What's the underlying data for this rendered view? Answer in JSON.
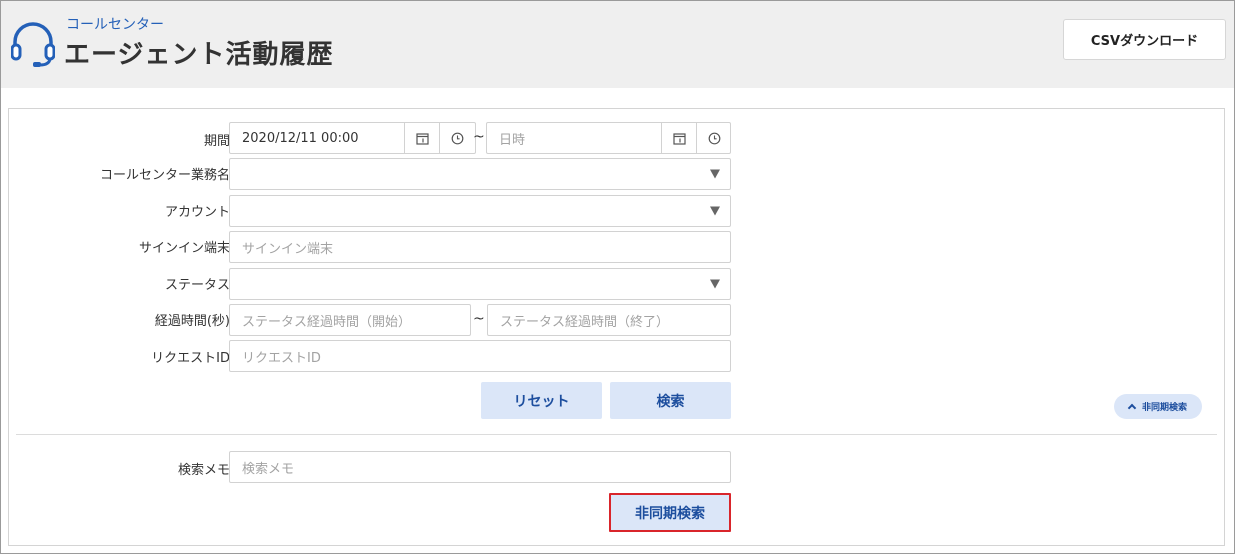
{
  "header": {
    "breadcrumb": "コールセンター",
    "title": "エージェント活動履歴",
    "csv_label": "CSVダウンロード",
    "icon": "headset-icon",
    "accent": "#2460b8"
  },
  "form": {
    "period": {
      "label": "期間",
      "start_value": "2020/12/11 00:00",
      "separator": "~",
      "end_placeholder": "日時",
      "calendar_icon": "calendar-icon",
      "clock_icon": "clock-icon"
    },
    "callcenter": {
      "label": "コールセンター業務名",
      "value": ""
    },
    "account": {
      "label": "アカウント",
      "value": ""
    },
    "signin": {
      "label": "サインイン端末",
      "placeholder": "サインイン端末"
    },
    "status": {
      "label": "ステータス",
      "value": ""
    },
    "elapsed": {
      "label": "経過時間(秒)",
      "start_placeholder": "ステータス経過時間（開始）",
      "separator": "~",
      "end_placeholder": "ステータス経過時間（終了）"
    },
    "request": {
      "label": "リクエストID",
      "placeholder": "リクエストID"
    },
    "reset_label": "リセット",
    "search_label": "検索",
    "toggle_label": "非同期検索"
  },
  "async": {
    "memo_label": "検索メモ",
    "memo_placeholder": "検索メモ",
    "button_label": "非同期検索",
    "highlight_color": "#d9252b"
  }
}
